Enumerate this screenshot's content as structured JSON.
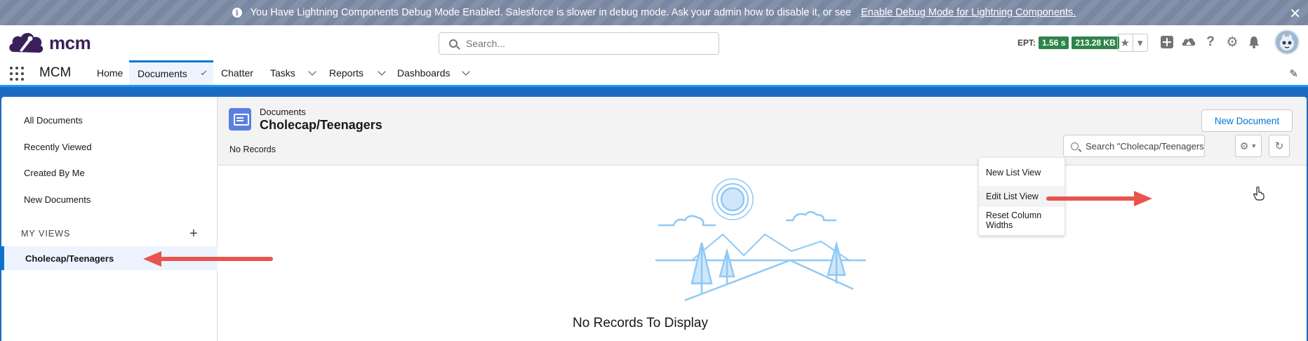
{
  "banner": {
    "message": "You Have Lightning Components Debug Mode Enabled. Salesforce is slower in debug mode. Ask your admin how to disable it, or see",
    "link": "Enable Debug Mode for Lightning Components.",
    "close": "✕",
    "info": "i"
  },
  "header": {
    "logo_text": "mcm",
    "search_placeholder": "Search...",
    "ept_label": "EPT:",
    "ept_time": "1.56 s",
    "ept_size": "213.28 KB"
  },
  "nav": {
    "app_name": "MCM",
    "tabs": [
      {
        "label": "Home"
      },
      {
        "label": "Documents"
      },
      {
        "label": "Chatter"
      },
      {
        "label": "Tasks"
      },
      {
        "label": "Reports"
      },
      {
        "label": "Dashboards"
      }
    ]
  },
  "sidebar": {
    "items": [
      {
        "label": "All Documents"
      },
      {
        "label": "Recently Viewed"
      },
      {
        "label": "Created By Me"
      },
      {
        "label": "New Documents"
      }
    ],
    "my_views_label": "MY VIEWS",
    "add_symbol": "+",
    "selected_view": "Cholecap/Teenagers"
  },
  "list_header": {
    "object_label": "Documents",
    "view_title": "Cholecap/Teenagers",
    "record_count": "No Records",
    "new_button": "New Document",
    "search_placeholder": "Search \"Cholecap/Teenagers\""
  },
  "menu": {
    "items": [
      {
        "label": "New List View"
      },
      {
        "label": "Edit List View"
      },
      {
        "label": "Reset Column Widths"
      }
    ],
    "hovered": "Edit List View"
  },
  "empty_state": {
    "message": "No Records To Display"
  },
  "colors": {
    "brand": "#0176d3",
    "banner": "#7e8ba6",
    "ept_badge": "#2e844a",
    "arrow": "#e8554e",
    "illustration": "#8ec9f5"
  }
}
